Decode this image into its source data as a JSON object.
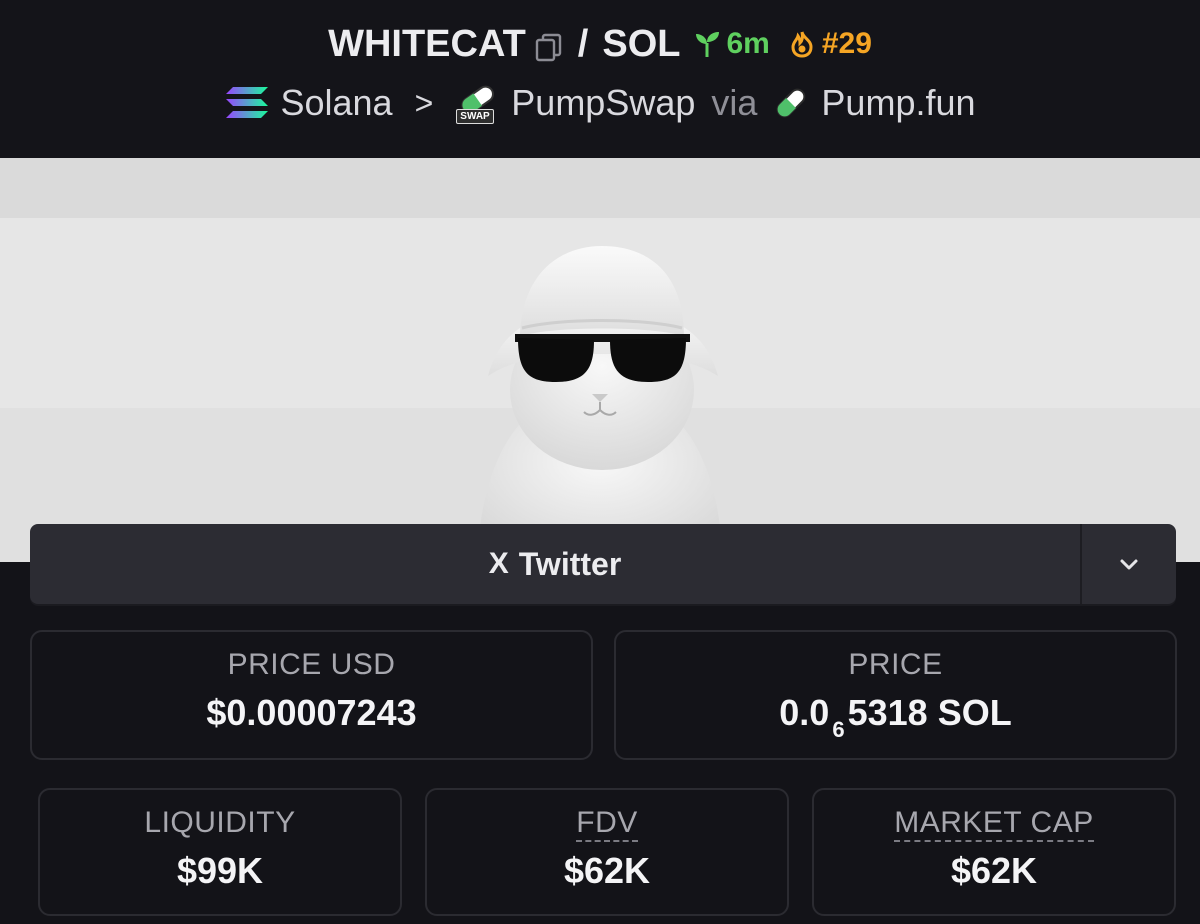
{
  "header": {
    "token": "WHITECAT",
    "separator": "/",
    "quote": "SOL",
    "age": "6m",
    "rank": "#29",
    "chain": "Solana",
    "crumb_sep": ">",
    "dex": "PumpSwap",
    "via": "via",
    "launchpad": "Pump.fun",
    "swap_tag": "SWAP"
  },
  "links": {
    "twitter": "Twitter",
    "x_glyph": "X"
  },
  "stats": {
    "price_usd": {
      "label": "PRICE USD",
      "value": "$0.00007243"
    },
    "price": {
      "label": "PRICE",
      "lead": "0.0",
      "zeros": "6",
      "digits": "5318",
      "unit": "SOL"
    },
    "liquidity": {
      "label": "LIQUIDITY",
      "value": "$99K"
    },
    "fdv": {
      "label": "FDV",
      "value": "$62K"
    },
    "market_cap": {
      "label": "MARKET CAP",
      "value": "$62K"
    }
  },
  "colors": {
    "age_green": "#5fd05f",
    "rank_orange": "#f5a524",
    "background": "#131318",
    "card_border": "#2b2b31"
  },
  "icons": [
    "copy-icon",
    "seedling-icon",
    "flame-icon",
    "solana-icon",
    "pumpswap-icon",
    "pill-icon",
    "x-icon",
    "chevron-down-icon"
  ]
}
